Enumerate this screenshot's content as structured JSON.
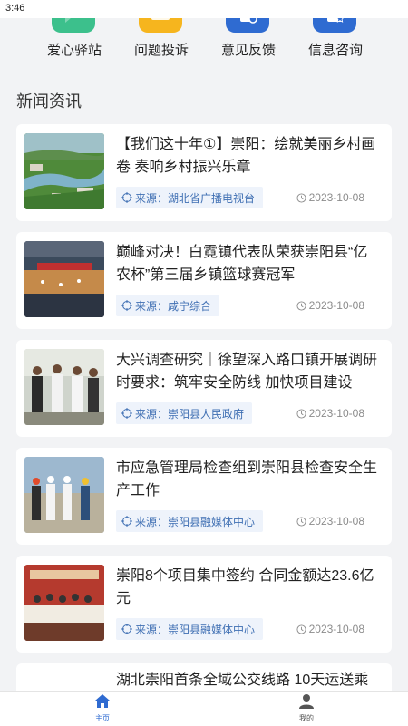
{
  "status_bar": {
    "time": "3:46"
  },
  "quick_actions": [
    {
      "label": "爱心驿站",
      "icon": "heart-chat-icon",
      "color": "#3cc08c"
    },
    {
      "label": "问题投诉",
      "icon": "mail-icon",
      "color": "#f6b51e"
    },
    {
      "label": "意见反馈",
      "icon": "feedback-doc-icon",
      "color": "#2f6bd1"
    },
    {
      "label": "信息咨询",
      "icon": "info-doc-icon",
      "color": "#2f6bd1"
    }
  ],
  "section_title": "新闻资讯",
  "news": [
    {
      "title": "【我们这十年①】崇阳：绘就美丽乡村画卷 奏响乡村振兴乐章",
      "source": "来源：湖北省广播电视台",
      "date": "2023-10-08",
      "thumb": "landscape-photo"
    },
    {
      "title": "巅峰对决！白霓镇代表队荣获崇阳县“亿农杯”第三届乡镇篮球赛冠军",
      "source": "来源：咸宁综合",
      "date": "2023-10-08",
      "thumb": "basketball-photo"
    },
    {
      "title": "大兴调查研究｜徐望深入路口镇开展调研时要求：筑牢安全防线 加快项目建设",
      "source": "来源：崇阳县人民政府",
      "date": "2023-10-08",
      "thumb": "inspection-photo"
    },
    {
      "title": "市应急管理局检查组到崇阳县检查安全生产工作",
      "source": "来源：崇阳县融媒体中心",
      "date": "2023-10-08",
      "thumb": "site-visit-photo"
    },
    {
      "title": "崇阳8个项目集中签约 合同金额达23.6亿元",
      "source": "来源：崇阳县融媒体中心",
      "date": "2023-10-08",
      "thumb": "signing-ceremony-photo"
    },
    {
      "title": "湖北崇阳首条全域公交线路 10天运送乘",
      "source": "",
      "date": "",
      "thumb": ""
    }
  ],
  "tabbar": [
    {
      "label": "主页",
      "icon": "home-icon",
      "active": true,
      "color": "#2f6bd1"
    },
    {
      "label": "我的",
      "icon": "user-icon",
      "active": false,
      "color": "#555555"
    }
  ]
}
